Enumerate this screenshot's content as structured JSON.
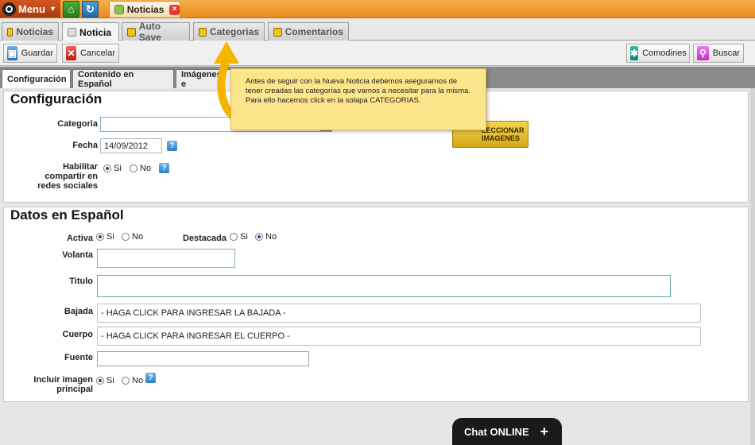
{
  "topbar": {
    "menu_label": "Menu",
    "window_tab": "Noticias",
    "window_close": "×"
  },
  "module_tabs": [
    {
      "label": "Noticias"
    },
    {
      "label": "Noticia"
    },
    {
      "label": "Auto Save"
    },
    {
      "label": "Categorias"
    },
    {
      "label": "Comentarios"
    }
  ],
  "toolbar": {
    "save": "Guardar",
    "cancel": "Cancelar",
    "wildcards": "Comodines",
    "search": "Buscar"
  },
  "form_tabs": [
    {
      "label": "Configuración"
    },
    {
      "label": "Contenido en Español"
    },
    {
      "label": "Imágenes e"
    }
  ],
  "config": {
    "title": "Configuración",
    "category_label": "Categoria",
    "category_value": "",
    "date_label": "Fecha",
    "date_value": "14/09/2012",
    "share_label_1": "Habilitar",
    "share_label_2": "compartir en",
    "share_label_3": "redes sociales",
    "yes": "Si",
    "no": "No",
    "select_images_1": "LECCIONAR",
    "select_images_2": "IMAGENES"
  },
  "spanish": {
    "title": "Datos en Español",
    "active_label": "Activa",
    "featured_label": "Destacada",
    "yes": "Si",
    "no": "No",
    "kicker_label": "Volanta",
    "title_label": "Titulo",
    "summary_label": "Bajada",
    "summary_value": "- HAGA CLICK PARA INGRESAR LA BAJADA -",
    "body_label": "Cuerpo",
    "body_value": "- HAGA CLICK PARA INGRESAR EL CUERPO -",
    "source_label": "Fuente",
    "include_image_1": "Incluir imagen",
    "include_image_2": "principal"
  },
  "tooltip": {
    "text": "Antes de seguir con la Nueva Noticia debemos asegurarnos de tener creadas las categorías que vamos a necesitar para la misma. Para ello hacemos click en la solapa CATEGORIAS."
  },
  "chat": {
    "label": "Chat ONLINE",
    "plus": "+"
  }
}
